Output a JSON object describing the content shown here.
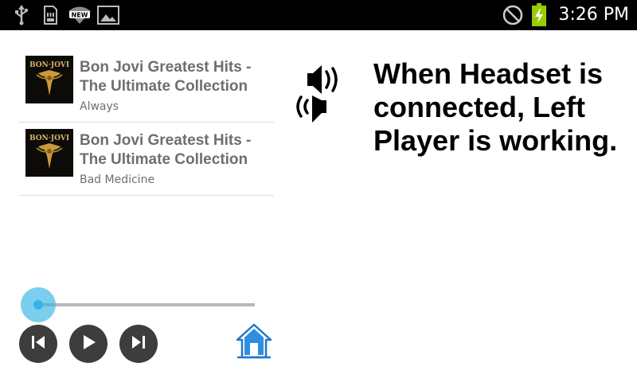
{
  "status_bar": {
    "time": "3:26 PM",
    "icons": [
      "usb-icon",
      "sd-card-icon",
      "new-wifi-icon",
      "gallery-icon",
      "do-not-disturb-icon",
      "battery-charging-icon"
    ],
    "new_badge": "NEW"
  },
  "song_list": {
    "items": [
      {
        "album": "Bon Jovi Greatest Hits - The Ultimate Collection",
        "title": "Always",
        "art_text": "BON·JOVI"
      },
      {
        "album": "Bon Jovi Greatest Hits - The Ultimate Collection",
        "title": "Bad Medicine",
        "art_text": "BON·JOVI"
      }
    ]
  },
  "message": "When Headset is connected, Left Player is working.",
  "seek_bar": {
    "progress": 0
  },
  "controls": {
    "icons": [
      "previous-icon",
      "play-icon",
      "next-icon",
      "home-icon"
    ]
  },
  "colors": {
    "accent": "#33b5e5",
    "control_bg": "#3d3d3d",
    "home_blue": "#1e78c8"
  }
}
